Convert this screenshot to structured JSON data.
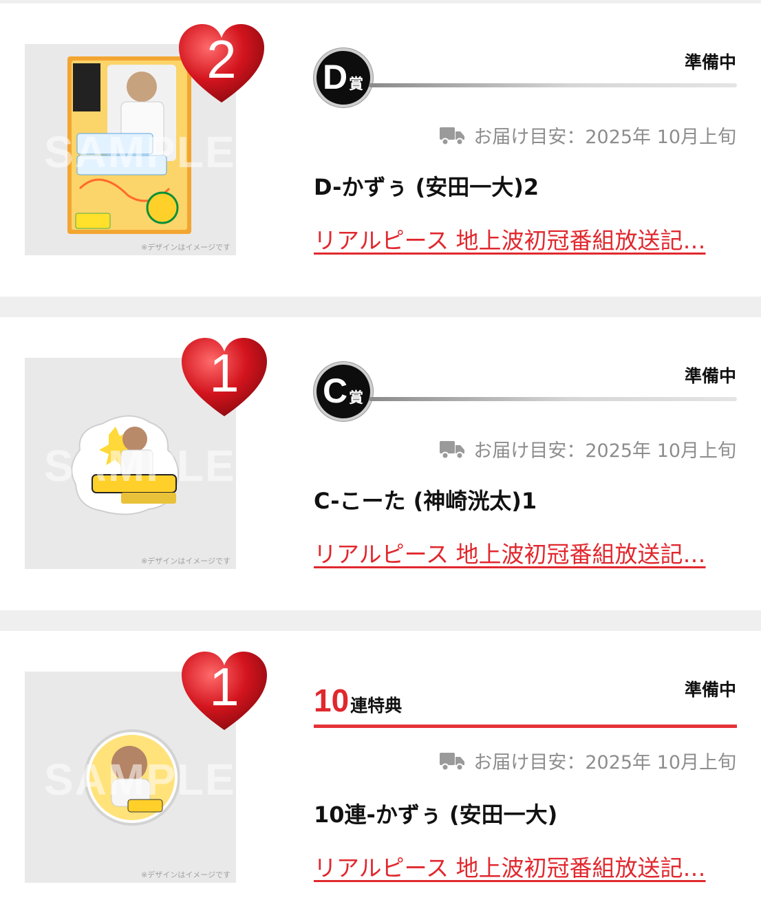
{
  "items": [
    {
      "heart_count": "2",
      "status": "準備中",
      "badge_type": "prize",
      "prize_letter": "D",
      "prize_suffix": "賞",
      "delivery": "お届け目安：2025年 10月上旬",
      "name": "D-かずぅ (安田一大)2",
      "link": "リアルピース 地上波初冠番組放送記…",
      "thumb_sample": "SAMPLE",
      "thumb_note": "※デザインはイメージです"
    },
    {
      "heart_count": "1",
      "status": "準備中",
      "badge_type": "prize",
      "prize_letter": "C",
      "prize_suffix": "賞",
      "delivery": "お届け目安：2025年 10月上旬",
      "name": "C-こーた (神崎洸太)1",
      "link": "リアルピース 地上波初冠番組放送記…",
      "thumb_sample": "SAMPLE",
      "thumb_note": "※デザインはイメージです"
    },
    {
      "heart_count": "1",
      "status": "準備中",
      "badge_type": "bonus",
      "bonus_number": "10",
      "bonus_text": "連特典",
      "delivery": "お届け目安：2025年 10月上旬",
      "name": "10連-かずぅ (安田一大)",
      "link": "リアルピース 地上波初冠番組放送記…",
      "thumb_sample": "SAMPLE",
      "thumb_note": "※デザインはイメージです"
    }
  ],
  "colors": {
    "accent_red": "#e0282e",
    "heart_red": "#c8101c",
    "muted_text": "#8d8d8d",
    "divider": "#efefef"
  },
  "icons": {
    "delivery": "truck-icon",
    "heart": "heart-icon"
  }
}
